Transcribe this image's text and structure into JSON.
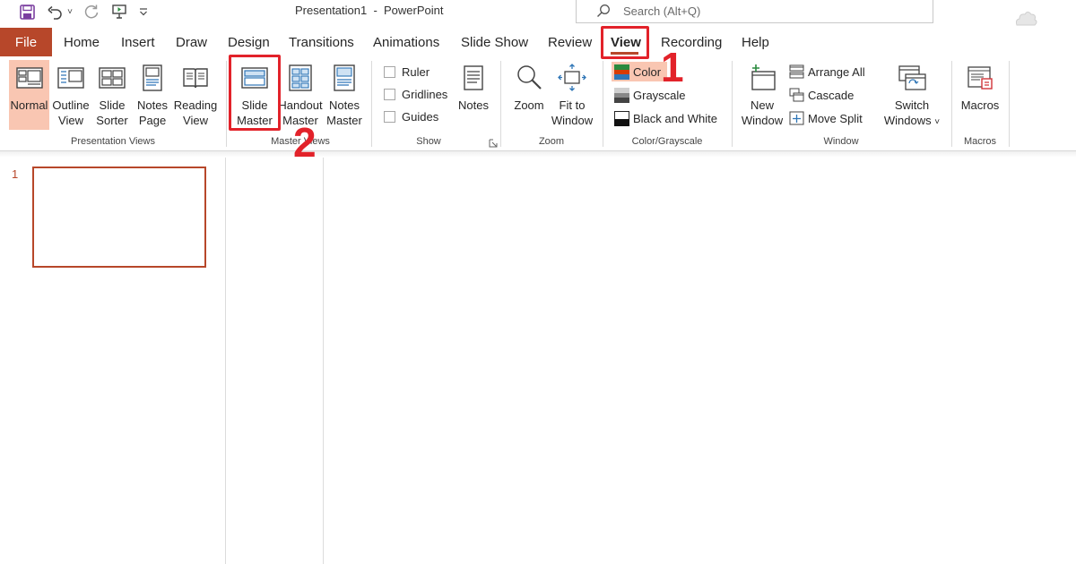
{
  "app": {
    "document_title": "Presentation1  -  PowerPoint",
    "search_placeholder": "Search (Alt+Q)"
  },
  "quick_access": [
    "save-icon",
    "undo-icon",
    "redo-icon",
    "start-from-beginning-icon",
    "customize-qat-icon"
  ],
  "tabs": {
    "file": "File",
    "items": [
      "Home",
      "Insert",
      "Draw",
      "Design",
      "Transitions",
      "Animations",
      "Slide Show",
      "Review",
      "View",
      "Recording",
      "Help"
    ],
    "active": "View"
  },
  "ribbon": {
    "presentation_views": {
      "label": "Presentation Views",
      "buttons": [
        {
          "line1": "Normal",
          "line2": ""
        },
        {
          "line1": "Outline",
          "line2": "View"
        },
        {
          "line1": "Slide",
          "line2": "Sorter"
        },
        {
          "line1": "Notes",
          "line2": "Page"
        },
        {
          "line1": "Reading",
          "line2": "View"
        }
      ]
    },
    "master_views": {
      "label": "Master Views",
      "buttons": [
        {
          "line1": "Slide",
          "line2": "Master"
        },
        {
          "line1": "Handout",
          "line2": "Master"
        },
        {
          "line1": "Notes",
          "line2": "Master"
        }
      ]
    },
    "show": {
      "label": "Show",
      "checkboxes": [
        "Ruler",
        "Gridlines",
        "Guides"
      ],
      "notes_button": "Notes"
    },
    "zoom": {
      "label": "Zoom",
      "buttons": [
        {
          "line1": "Zoom",
          "line2": ""
        },
        {
          "line1": "Fit to",
          "line2": "Window"
        }
      ]
    },
    "color_grayscale": {
      "label": "Color/Grayscale",
      "items": [
        "Color",
        "Grayscale",
        "Black and White"
      ]
    },
    "window": {
      "label": "Window",
      "new_window": {
        "line1": "New",
        "line2": "Window"
      },
      "small": [
        "Arrange All",
        "Cascade",
        "Move Split"
      ],
      "switch_windows": {
        "line1": "Switch",
        "line2": "Windows"
      }
    },
    "macros": {
      "label": "Macros",
      "button": "Macros"
    }
  },
  "annotations": {
    "step1": "1",
    "step2": "2"
  },
  "slides": {
    "thumbnail_number": "1"
  },
  "colors": {
    "accent": "#b7472a",
    "annotation": "#e2222a",
    "normal_highlight": "#f9c6b2"
  }
}
